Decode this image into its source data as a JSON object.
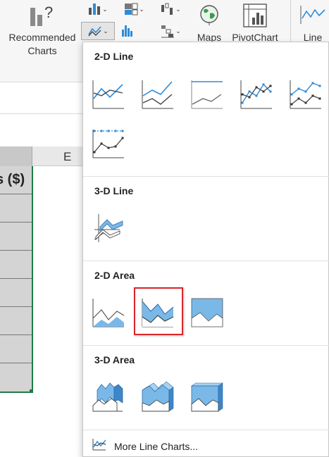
{
  "ribbon": {
    "recommended_charts_label": "Recommended\nCharts",
    "maps_label": "Maps",
    "pivotchart_label": "PivotChart",
    "line_label": "Line",
    "caret": "⌄"
  },
  "sheet": {
    "column_e_header": "E",
    "header_cell_text": "s ($)"
  },
  "menu": {
    "sections": [
      {
        "title": "2-D Line"
      },
      {
        "title": "3-D Line"
      },
      {
        "title": "2-D Area"
      },
      {
        "title": "3-D Area"
      }
    ],
    "more_label": "More Line Charts..."
  },
  "colors": {
    "accent_blue": "#2e8bd8",
    "area_fill": "#7ab8e8",
    "selection_red": "#d9262b",
    "selection_green": "#1f7a45"
  }
}
